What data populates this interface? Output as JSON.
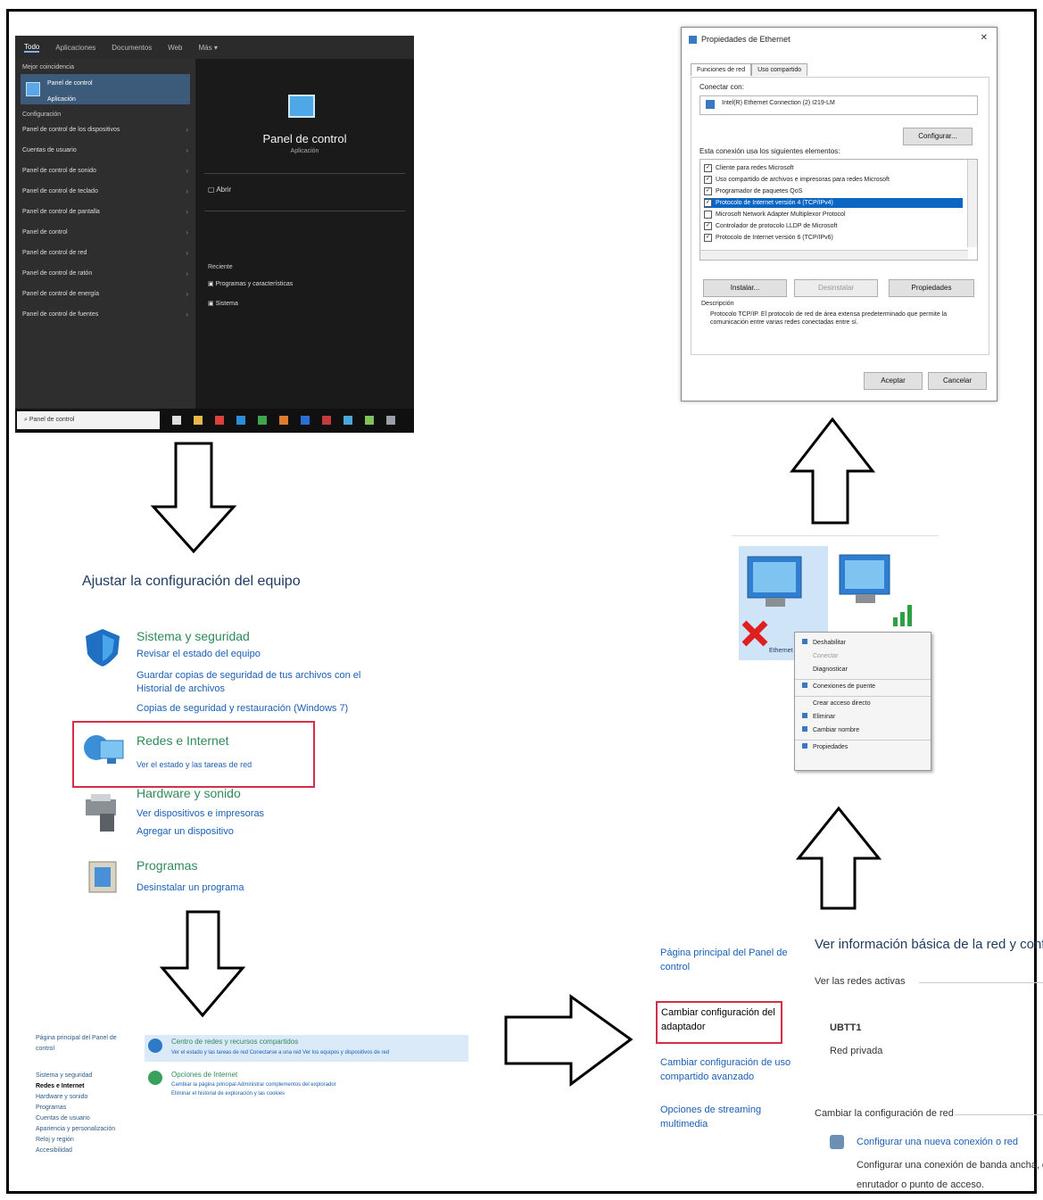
{
  "start_menu": {
    "tabs": [
      "Todo",
      "Aplicaciones",
      "Documentos",
      "Web",
      "Más ▾"
    ],
    "section_best": "Mejor coincidencia",
    "best_title": "Panel de control",
    "best_sub": "Aplicación",
    "section_settings": "Configuración",
    "items": [
      "Panel de control de los dispositivos",
      "Cuentas de usuario",
      "Panel de control de sonido",
      "Panel de control de teclado",
      "Panel de control de pantalla",
      "Panel de control",
      "Panel de control de red",
      "Panel de control de ratón",
      "Panel de control de energía",
      "Panel de control de fuentes"
    ],
    "right_title": "Panel de control",
    "right_sub": "Aplicación",
    "open": "Abrir",
    "recent_label": "Reciente",
    "recent_items": [
      "Programas y características",
      "Sistema"
    ],
    "search_text": "Panel de control"
  },
  "control_panel": {
    "title": "Ajustar la configuración del equipo",
    "categories": [
      {
        "title": "Sistema y seguridad",
        "links": [
          "Revisar el estado del equipo",
          "Guardar copias de seguridad de tus archivos con el Historial de archivos",
          "Copias de seguridad y restauración (Windows 7)"
        ]
      },
      {
        "title": "Redes e Internet",
        "links": [
          "Ver el estado y las tareas de red"
        ]
      },
      {
        "title": "Hardware y sonido",
        "links": [
          "Ver dispositivos e impresoras",
          "Agregar un dispositivo"
        ]
      },
      {
        "title": "Programas",
        "links": [
          "Desinstalar un programa"
        ]
      }
    ]
  },
  "network_strip": {
    "sidebar": [
      "Página principal del Panel de control",
      "Sistema y seguridad",
      "Redes e Internet",
      "Hardware y sonido",
      "Programas",
      "Cuentas de usuario",
      "Apariencia y personalización",
      "Reloj y región",
      "Accesibilidad"
    ],
    "item1_title": "Centro de redes y recursos compartidos",
    "item1_links": "Ver el estado y las tareas de red     Conectarse a una red     Ver los equipos y dispositivos de red",
    "item2_title": "Opciones de Internet",
    "item2_links": "Cambiar la página principal     Administrar complementos del explorador",
    "item2_links2": "Eliminar el historial de exploración y las cookies"
  },
  "network_center": {
    "side_links": [
      "Página principal del Panel de control",
      "Cambiar configuración del adaptador",
      "Cambiar configuración de uso compartido avanzado",
      "Opciones de streaming multimedia"
    ],
    "heading": "Ver información básica de la red y config",
    "active_label": "Ver las redes activas",
    "network_name": "UBTT1",
    "network_type": "Red privada",
    "change_label": "Cambiar la configuración de red",
    "setup_title": "Configurar una nueva conexión o red",
    "setup_desc": "Configurar una conexión de banda ancha, de",
    "setup_desc2": "enrutador o punto de acceso."
  },
  "context_menu": {
    "items": [
      "Deshabilitar",
      "Conectar",
      "Diagnosticar",
      "Conexiones de puente",
      "Crear acceso directo",
      "Eliminar",
      "Cambiar nombre",
      "Propiedades"
    ]
  },
  "adapter_label": "Ethernet",
  "dialog": {
    "title": "Propiedades de Ethernet",
    "tabs": [
      "Funciones de red",
      "Uso compartido"
    ],
    "connect_label": "Conectar con:",
    "adapter": "Intel(R) Ethernet Connection (2) I219-LM",
    "configure": "Configurar...",
    "components_label": "Esta conexión usa los siguientes elementos:",
    "components": [
      {
        "text": "Cliente para redes Microsoft",
        "checked": true
      },
      {
        "text": "Uso compartido de archivos e impresoras para redes Microsoft",
        "checked": true
      },
      {
        "text": "Programador de paquetes QoS",
        "checked": true
      },
      {
        "text": "Protocolo de Internet versión 4 (TCP/IPv4)",
        "checked": true
      },
      {
        "text": "Microsoft Network Adapter Multiplexor Protocol",
        "checked": false
      },
      {
        "text": "Controlador de protocolo LLDP de Microsoft",
        "checked": true
      },
      {
        "text": "Protocolo de Internet versión 6 (TCP/IPv6)",
        "checked": true
      }
    ],
    "install": "Instalar...",
    "uninstall": "Desinstalar",
    "properties": "Propiedades",
    "description_label": "Descripción",
    "description": "Protocolo TCP/IP. El protocolo de red de área extensa predeterminado que permite la comunicación entre varias redes conectadas entre sí.",
    "ok": "Aceptar",
    "cancel": "Cancelar"
  }
}
